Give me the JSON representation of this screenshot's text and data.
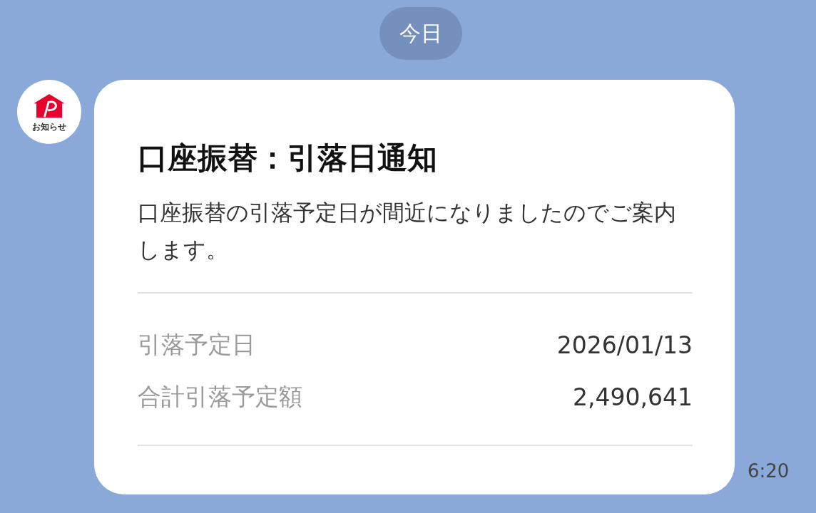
{
  "date_chip": "今日",
  "sender": {
    "avatar_label": "お知らせ"
  },
  "message": {
    "title": "口座振替：引落日通知",
    "body": "口座振替の引落予定日が間近になりましたのでご案内します。",
    "rows": [
      {
        "label": "引落予定日",
        "value": "2026/01/13"
      },
      {
        "label": "合計引落予定額",
        "value": "2,490,641"
      }
    ]
  },
  "time": "6:20"
}
